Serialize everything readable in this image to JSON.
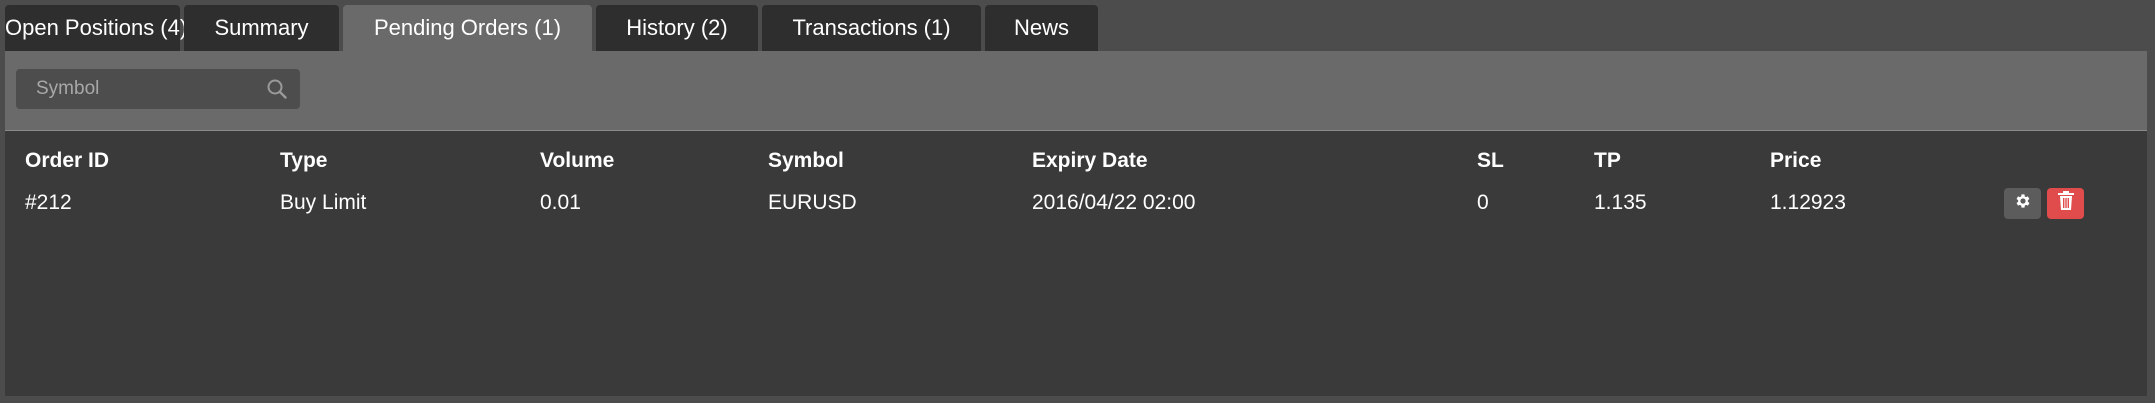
{
  "tabs": [
    {
      "label": "Open Positions (4)",
      "active": false
    },
    {
      "label": "Summary",
      "active": false
    },
    {
      "label": "Pending Orders (1)",
      "active": true
    },
    {
      "label": "History (2)",
      "active": false
    },
    {
      "label": "Transactions (1)",
      "active": false
    },
    {
      "label": "News",
      "active": false
    }
  ],
  "filter": {
    "symbol_placeholder": "Symbol",
    "symbol_value": ""
  },
  "table": {
    "headers": {
      "order_id": "Order ID",
      "type": "Type",
      "volume": "Volume",
      "symbol": "Symbol",
      "expiry_date": "Expiry Date",
      "sl": "SL",
      "tp": "TP",
      "price": "Price"
    },
    "rows": [
      {
        "order_id": "#212",
        "type": "Buy Limit",
        "volume": "0.01",
        "symbol": "EURUSD",
        "expiry_date": "2016/04/22 02:00",
        "sl": "0",
        "tp": "1.135",
        "price": "1.12923"
      }
    ]
  },
  "icons": {
    "search": "search-icon",
    "settings": "gear-icon",
    "delete": "trash-icon"
  },
  "colors": {
    "background": "#4c4c4c",
    "tab": "#2e2e2e",
    "tab_active": "#6a6a6a",
    "panel": "#3a3a3a",
    "delete_button": "#e04b4b",
    "settings_button": "#5c5c5c"
  }
}
